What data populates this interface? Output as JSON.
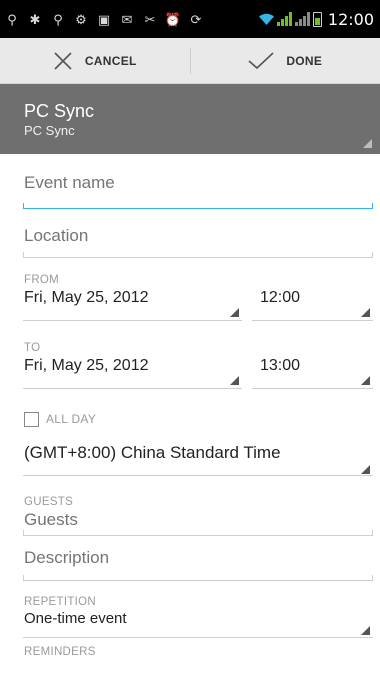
{
  "status_bar": {
    "time": "12:00",
    "icons": [
      "usb-icon",
      "usb-debug-icon",
      "usb-icon",
      "settings-icon",
      "image-icon",
      "message-icon",
      "tools-icon",
      "alarm-icon",
      "sync-icon",
      "wifi-icon",
      "signal-icon",
      "signal-icon",
      "battery-icon"
    ]
  },
  "action_bar": {
    "cancel_label": "CANCEL",
    "done_label": "DONE"
  },
  "calendar": {
    "title": "PC Sync",
    "subtitle": "PC Sync"
  },
  "form": {
    "event_name_placeholder": "Event name",
    "location_placeholder": "Location",
    "from_label": "FROM",
    "from_date": "Fri, May 25, 2012",
    "from_time": "12:00",
    "to_label": "TO",
    "to_date": "Fri, May 25, 2012",
    "to_time": "13:00",
    "all_day_label": "ALL DAY",
    "timezone": "(GMT+8:00) China Standard Time",
    "guests_label": "GUESTS",
    "guests_placeholder": "Guests",
    "description_placeholder": "Description",
    "repetition_label": "REPETITION",
    "repetition_value": "One-time event",
    "reminders_label": "REMINDERS"
  },
  "colors": {
    "focus_accent": "#33b5e5",
    "header_bg": "#6f6f6f",
    "action_bar_bg": "#e9e9e9"
  }
}
